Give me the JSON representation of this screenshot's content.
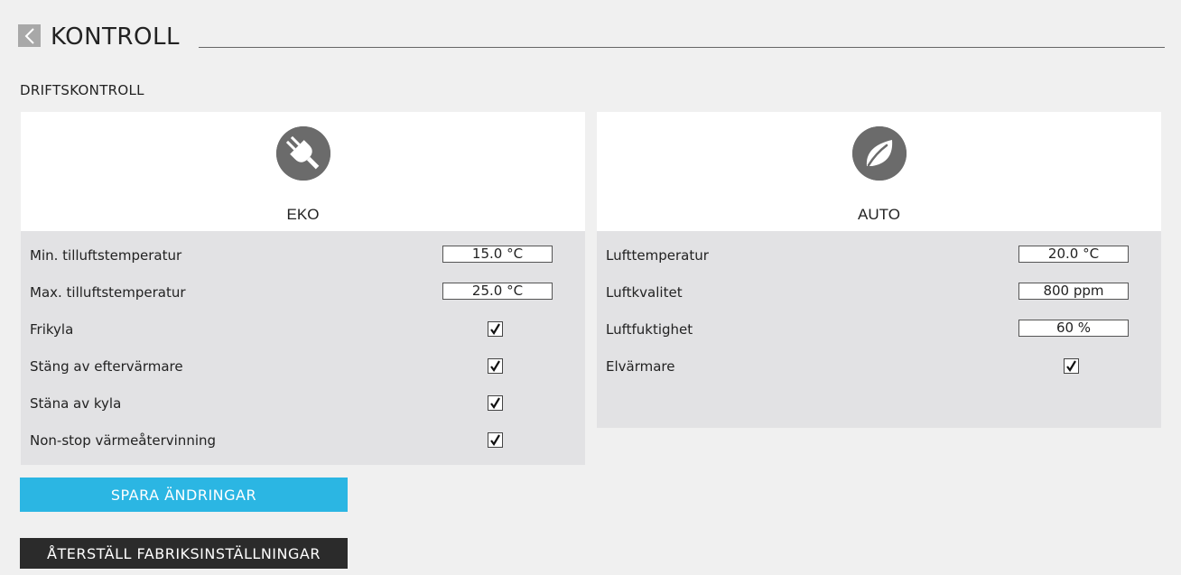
{
  "header": {
    "title": "KONTROLL",
    "back_icon": "chevron-left-icon"
  },
  "section": {
    "title": "DRIFTSKONTROLL"
  },
  "panels": {
    "eko": {
      "label": "EKO",
      "icon": "plug-icon",
      "fields": [
        {
          "label": "Min. tilluftstemperatur",
          "value": "15.0  °C"
        },
        {
          "label": "Max. tilluftstemperatur",
          "value": "25.0 °C"
        }
      ],
      "checks": [
        {
          "label": "Frikyla",
          "checked": true
        },
        {
          "label": "Stäng av eftervärmare",
          "checked": true
        },
        {
          "label": "Stäna av kyla",
          "checked": true
        },
        {
          "label": "Non-stop värmeåtervinning",
          "checked": true
        }
      ]
    },
    "auto": {
      "label": "AUTO",
      "icon": "leaf-icon",
      "fields": [
        {
          "label": "Lufttemperatur",
          "value": "20.0  °C"
        },
        {
          "label": "Luftkvalitet",
          "value": "800 ppm"
        },
        {
          "label": "Luftfuktighet",
          "value": "60 %"
        }
      ],
      "checks": [
        {
          "label": "Elvärmare",
          "checked": true
        }
      ]
    }
  },
  "buttons": {
    "save": "SPARA ÄNDRINGAR",
    "reset": "ÅTERSTÄLL FABRIKSINSTÄLLNINGAR"
  },
  "colors": {
    "accent": "#2bb6e3",
    "dark_button": "#2b2b2b",
    "panel_body": "#e2e2e4",
    "icon": "#6b6b6b"
  }
}
